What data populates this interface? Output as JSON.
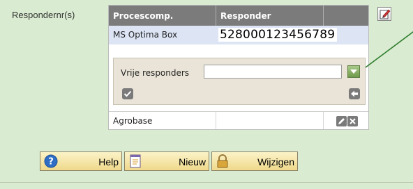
{
  "field": {
    "label": "Respondernr(s)"
  },
  "table": {
    "headers": [
      "Procescomp.",
      "Responder"
    ],
    "rows": [
      {
        "name": "MS Optima Box",
        "responder": "528000123456789"
      },
      {
        "name": "Agrobase",
        "responder": ""
      }
    ],
    "panel": {
      "free_label": "Vrije responders",
      "free_value": ""
    }
  },
  "buttons": {
    "help": "Help",
    "new": "Nieuw",
    "change": "Wijzigen"
  },
  "icons": {
    "edit": "edit-form-icon",
    "dropdown": "dropdown-arrow-icon",
    "confirm": "check-icon",
    "back": "back-arrow-icon",
    "row_edit": "pencil-icon",
    "row_delete": "delete-x-icon",
    "help": "help-circle-icon",
    "new": "notepad-icon",
    "change": "lock-icon"
  },
  "colors": {
    "background": "#d9ebd0",
    "header": "#7b7b7b",
    "selected_row": "#dde5f5",
    "button": "#f3e3a3",
    "connector": "#2e7d2e"
  }
}
